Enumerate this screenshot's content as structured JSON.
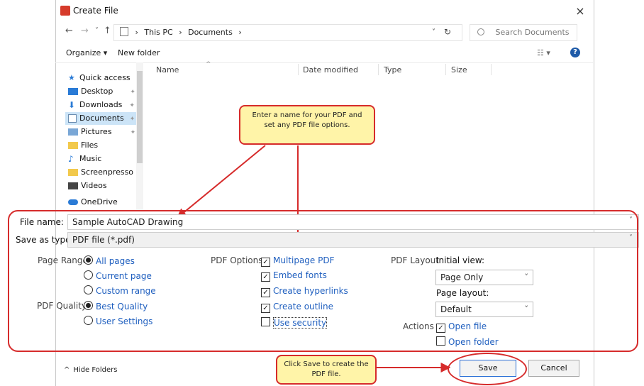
{
  "window": {
    "title": "Create File",
    "close_icon": "×"
  },
  "nav": {
    "back": "←",
    "forward": "→",
    "recent": "˅",
    "up": "↑",
    "breadcrumb": [
      "This PC",
      "Documents"
    ],
    "sep": "›",
    "dropdown": "˅",
    "refresh": "↻",
    "search_placeholder": "Search Documents"
  },
  "toolbar": {
    "organize": "Organize ▾",
    "new_folder": "New folder",
    "view": "☷ ▾",
    "help": "?"
  },
  "sidebar": {
    "items": [
      {
        "label": "Quick access",
        "icon": "star-icon"
      },
      {
        "label": "Desktop",
        "icon": "desktop-icon"
      },
      {
        "label": "Downloads",
        "icon": "download-icon"
      },
      {
        "label": "Documents",
        "icon": "documents-icon"
      },
      {
        "label": "Pictures",
        "icon": "pictures-icon"
      },
      {
        "label": "Files",
        "icon": "folder-icon"
      },
      {
        "label": "Music",
        "icon": "music-icon"
      },
      {
        "label": "Screenpresso",
        "icon": "folder-icon"
      },
      {
        "label": "Videos",
        "icon": "videos-icon"
      },
      {
        "label": "OneDrive",
        "icon": "cloud-icon"
      }
    ]
  },
  "columns": [
    "Name",
    "Date modified",
    "Type",
    "Size"
  ],
  "file_name": {
    "label": "File name:",
    "value": "Sample AutoCAD Drawing"
  },
  "save_type": {
    "label": "Save as type:",
    "value": "PDF file (*.pdf)"
  },
  "page_range": {
    "label": "Page Range",
    "options": [
      "All pages",
      "Current page",
      "Custom range"
    ]
  },
  "pdf_quality": {
    "label": "PDF Quality",
    "options": [
      "Best Quality",
      "User Settings"
    ]
  },
  "pdf_options": {
    "label": "PDF Options",
    "items": [
      {
        "label": "Multipage PDF",
        "checked": true
      },
      {
        "label": "Embed fonts",
        "checked": true
      },
      {
        "label": "Create hyperlinks",
        "checked": true
      },
      {
        "label": "Create outline",
        "checked": true
      },
      {
        "label": "Use security",
        "checked": false
      }
    ]
  },
  "pdf_layout": {
    "label": "PDF Layout",
    "initial_view_label": "Initial view:",
    "initial_view_value": "Page Only",
    "page_layout_label": "Page layout:",
    "page_layout_value": "Default"
  },
  "actions": {
    "label": "Actions",
    "items": [
      {
        "label": "Open file",
        "checked": true
      },
      {
        "label": "Open folder",
        "checked": false
      }
    ]
  },
  "footer": {
    "hide_folders": "Hide Folders",
    "save": "Save",
    "cancel": "Cancel"
  },
  "callouts": {
    "top": "Enter a name for your PDF and set any PDF file options.",
    "bottom": "Click Save to create the PDF file."
  },
  "colors": {
    "annotation": "#d62b2b",
    "callout_bg": "#fff4a8",
    "link": "#1f5fbf"
  }
}
